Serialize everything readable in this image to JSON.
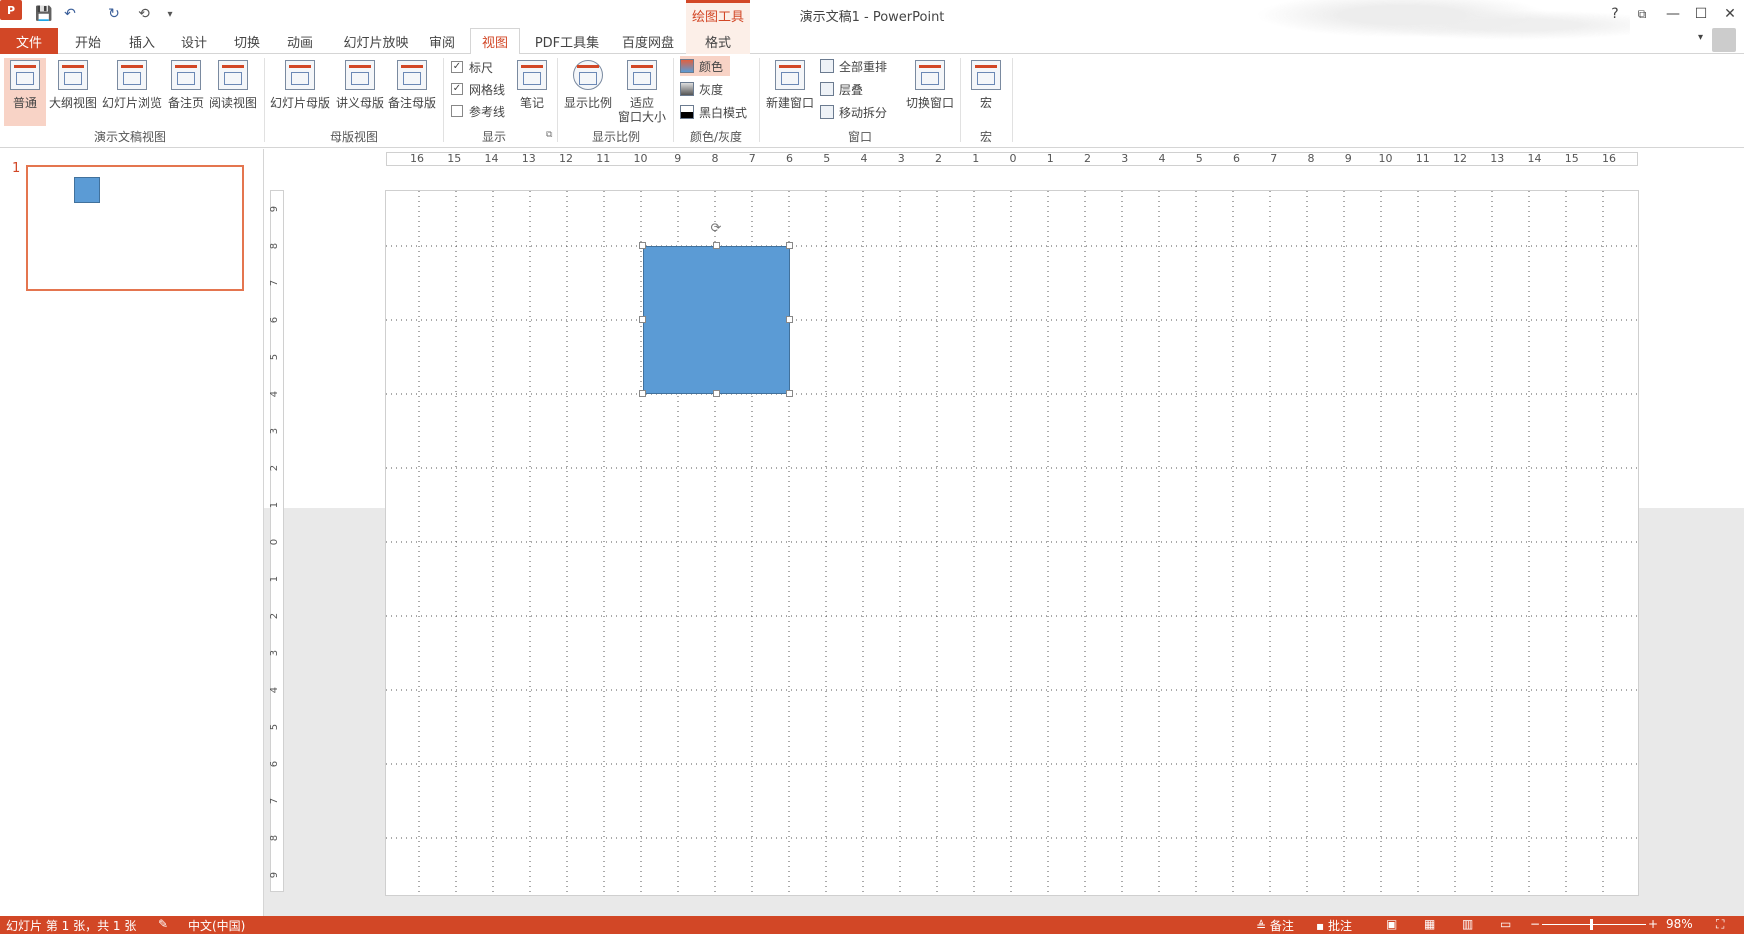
{
  "window": {
    "title": "演示文稿1 - PowerPoint",
    "app_icon": "P",
    "contextual_tab_group": "绘图工具",
    "help": "?",
    "restore_ribbon": "⧉",
    "minimize": "—",
    "maximize": "☐",
    "close": "✕"
  },
  "qat": {
    "save_icon": "💾",
    "undo_icon": "↶",
    "redo_icon": "↻",
    "present_icon": "⟲",
    "customize_icon": "▾"
  },
  "tabs": [
    "文件",
    "开始",
    "插入",
    "设计",
    "切换",
    "动画",
    "幻灯片放映",
    "审阅",
    "视图",
    "PDF工具集",
    "百度网盘",
    "格式"
  ],
  "active_tab": "视图",
  "ribbon": {
    "groups": {
      "presentation_views": "演示文稿视图",
      "master_views": "母版视图",
      "show": "显示",
      "zoom": "显示比例",
      "color_gray": "颜色/灰度",
      "window": "窗口",
      "macros": "宏"
    },
    "buttons": {
      "normal": "普通",
      "outline": "大纲视图",
      "slide_sorter": "幻灯片浏览",
      "notes_page": "备注页",
      "reading_view": "阅读视图",
      "slide_master": "幻灯片母版",
      "handout_master": "讲义母版",
      "notes_master": "备注母版",
      "notes": "笔记",
      "zoom": "显示比例",
      "fit_line1": "适应",
      "fit_line2": "窗口大小",
      "new_window": "新建窗口",
      "switch_windows": "切换窗口",
      "macros": "宏"
    },
    "checks": {
      "ruler": "标尺",
      "gridlines": "网格线",
      "guides": "参考线",
      "ruler_checked": "✓",
      "gridlines_checked": "✓"
    },
    "color_modes": [
      "颜色",
      "灰度",
      "黑白模式"
    ],
    "window_small": [
      "全部重排",
      "层叠",
      "移动拆分"
    ],
    "dialog_launcher": "⧉",
    "collapse": "⌃"
  },
  "thumbnails": {
    "slide_number": "1"
  },
  "rulers": {
    "horizontal": [
      "16",
      "15",
      "14",
      "13",
      "12",
      "11",
      "10",
      "9",
      "8",
      "7",
      "6",
      "5",
      "4",
      "3",
      "2",
      "1",
      "0",
      "1",
      "2",
      "3",
      "4",
      "5",
      "6",
      "7",
      "8",
      "9",
      "10",
      "11",
      "12",
      "13",
      "14",
      "15",
      "16"
    ],
    "vertical": [
      "9",
      "8",
      "7",
      "6",
      "5",
      "4",
      "3",
      "2",
      "1",
      "0",
      "1",
      "2",
      "3",
      "4",
      "5",
      "6",
      "7",
      "8",
      "9"
    ]
  },
  "statusbar": {
    "slide_info": "幻灯片 第 1 张，共 1 张",
    "language": "中文(中国)",
    "notes": "备注",
    "comments": "批注",
    "zoom_minus": "−",
    "zoom_plus": "+",
    "zoom_level": "98%",
    "fit_icon": "⛶"
  },
  "colors": {
    "accent": "#d24726",
    "shape_fill": "#5b9bd5",
    "shape_border": "#41719c"
  }
}
